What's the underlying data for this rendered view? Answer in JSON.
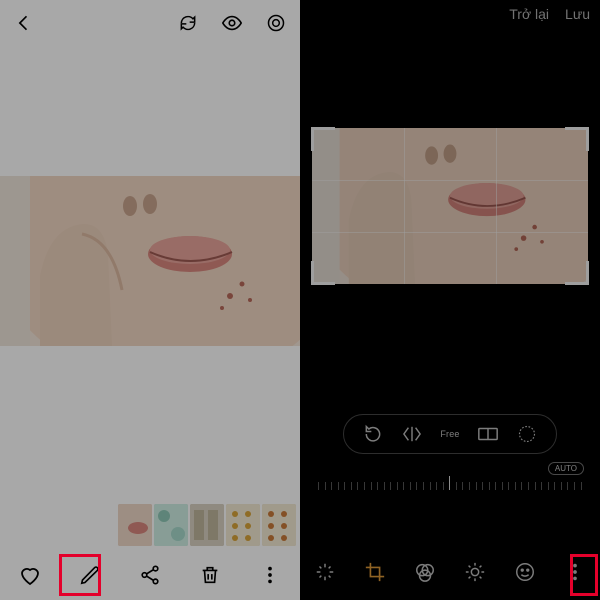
{
  "left": {
    "bottom": {
      "heart": "heart-icon",
      "edit": "pencil-icon",
      "share": "share-icon",
      "trash": "trash-icon",
      "more": "more-icon"
    }
  },
  "right": {
    "top": {
      "back": "Trở lại",
      "save": "Lưu"
    },
    "tools": {
      "rotate": "↺",
      "flip": "⟨|⟩",
      "free": "Free",
      "aspect": "▭",
      "circle": "◌"
    },
    "ruler": {
      "auto": "AUTO"
    },
    "bottom": {
      "magic": "sparkle-icon",
      "crop": "crop-icon",
      "filter": "filter-icon",
      "brightness": "sun-icon",
      "emoji": "emoji-icon",
      "more": "more-icon"
    }
  }
}
